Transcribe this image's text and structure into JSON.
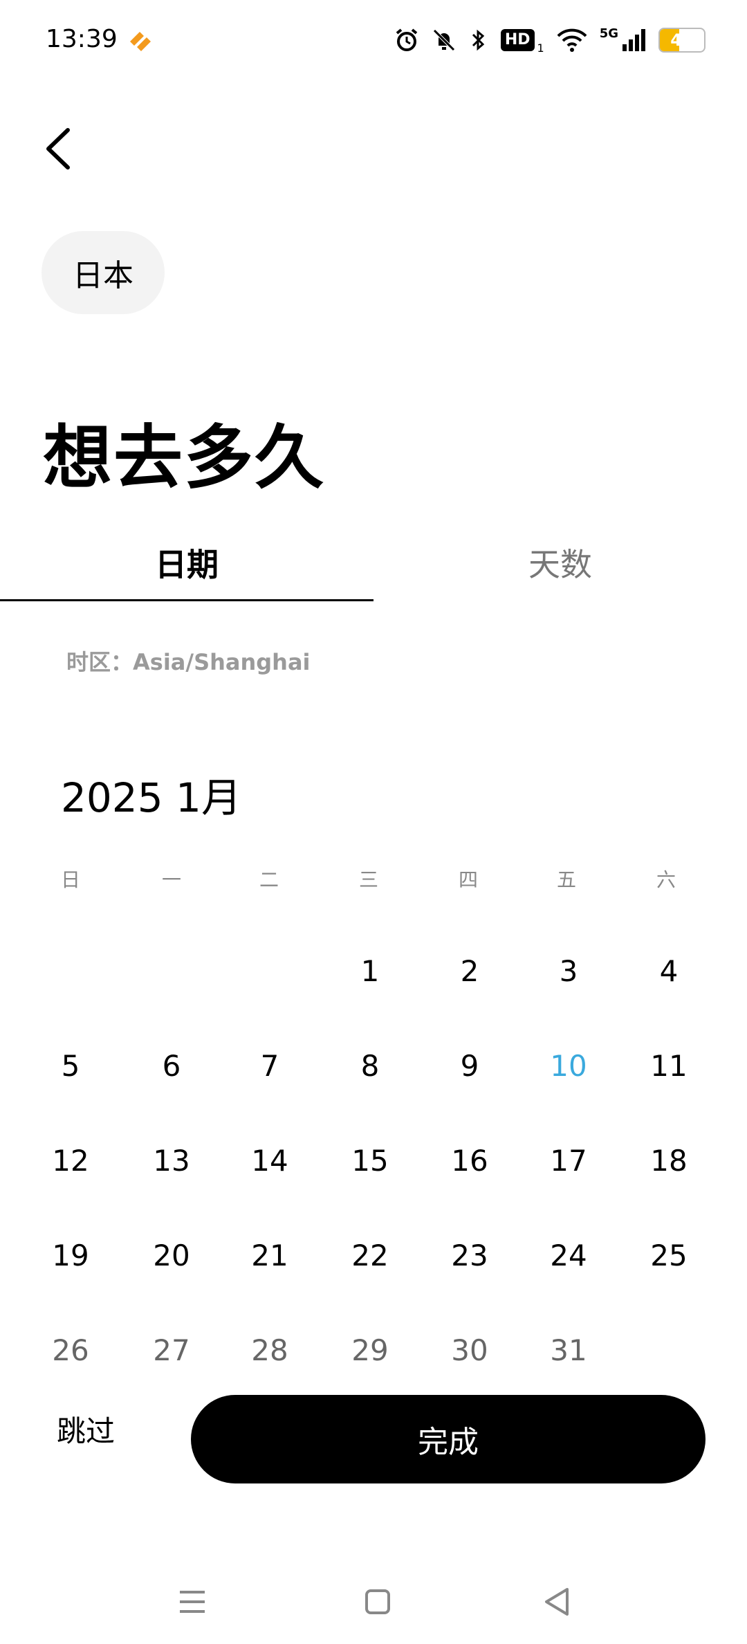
{
  "status_bar": {
    "time": "13:39",
    "hd_label": "HD",
    "hd_sub": "1",
    "network": "5G",
    "battery": "43",
    "battery_level": 0.43,
    "icons": [
      "app-notification-icon",
      "alarm-icon",
      "mute-bell-icon",
      "bluetooth-icon",
      "wifi-icon",
      "signal-icon",
      "battery-icon"
    ]
  },
  "header": {
    "back_icon": "back-arrow-icon"
  },
  "country_chip": "日本",
  "page_title": "想去多久",
  "tabs": [
    {
      "label": "日期",
      "selected": true
    },
    {
      "label": "天数",
      "selected": false
    }
  ],
  "timezone": "时区：Asia/Shanghai",
  "calendar": {
    "month_label": "2025 1月",
    "weekdays": [
      "日",
      "一",
      "二",
      "三",
      "四",
      "五",
      "六"
    ],
    "first_weekday_index": 3,
    "days": [
      "1",
      "2",
      "3",
      "4",
      "5",
      "6",
      "7",
      "8",
      "9",
      "10",
      "11",
      "12",
      "13",
      "14",
      "15",
      "16",
      "17",
      "18",
      "19",
      "20",
      "21",
      "22",
      "23",
      "24",
      "25",
      "26",
      "27",
      "28",
      "29",
      "30",
      "31"
    ],
    "today": "10",
    "today_color": "#3aa9dd"
  },
  "actions": {
    "skip_label": "跳过",
    "done_label": "完成"
  },
  "nav_bar": {
    "icons": [
      "menu-icon",
      "home-icon",
      "back-triangle-icon"
    ]
  }
}
